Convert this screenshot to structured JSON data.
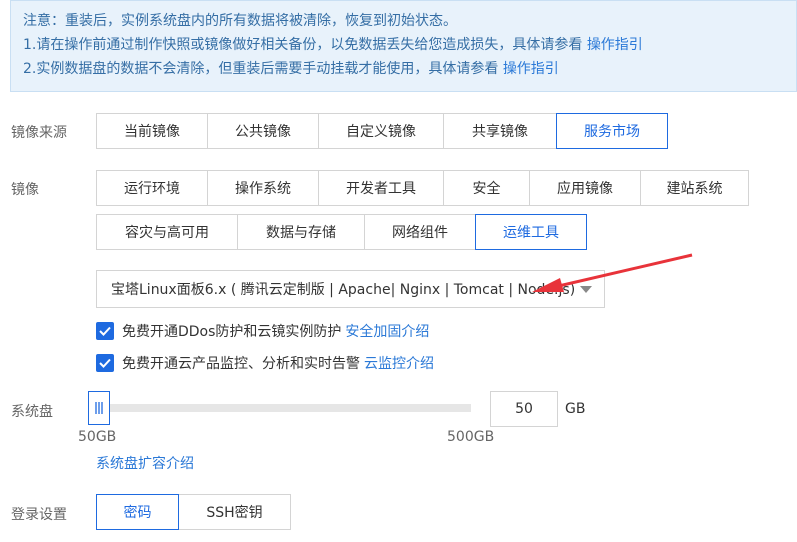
{
  "notice": {
    "line1": "注意：重装后，实例系统盘内的所有数据将被清除，恢复到初始状态。",
    "line2_text": "1.请在操作前通过制作快照或镜像做好相关备份，以免数据丢失给您造成损失，具体请参看",
    "line2_link": "操作指引",
    "line3_text": "2.实例数据盘的数据不会清除，但重装后需要手动挂载才能使用，具体请参看",
    "line3_link": "操作指引"
  },
  "image_source": {
    "label": "镜像来源",
    "options": [
      "当前镜像",
      "公共镜像",
      "自定义镜像",
      "共享镜像",
      "服务市场"
    ],
    "selected": "服务市场"
  },
  "image": {
    "label": "镜像",
    "categories_row1": [
      "运行环境",
      "操作系统",
      "开发者工具",
      "安全",
      "应用镜像",
      "建站系统"
    ],
    "categories_row2": [
      "容灾与高可用",
      "数据与存储",
      "网络组件",
      "运维工具"
    ],
    "selected": "运维工具",
    "select_value": "宝塔Linux面板6.x ( 腾讯云定制版 | Apache| Nginx | Tomcat | Node.js)"
  },
  "checkboxes": [
    {
      "label": "免费开通DDos防护和云镜实例防护",
      "link": "安全加固介绍",
      "checked": true
    },
    {
      "label": "免费开通云产品监控、分析和实时告警",
      "link": "云监控介绍",
      "checked": true
    }
  ],
  "system_disk": {
    "label": "系统盘",
    "value": "50",
    "unit": "GB",
    "min_label": "50GB",
    "max_label": "500GB",
    "level": 0,
    "link": "系统盘扩容介绍"
  },
  "login": {
    "label": "登录设置",
    "options": [
      "密码",
      "SSH密钥"
    ],
    "selected": "密码"
  },
  "colors": {
    "accent": "#1e6ae0",
    "link": "#2b79d7",
    "notice_bg": "#e8f2fb",
    "arrow": "#e8333a"
  }
}
